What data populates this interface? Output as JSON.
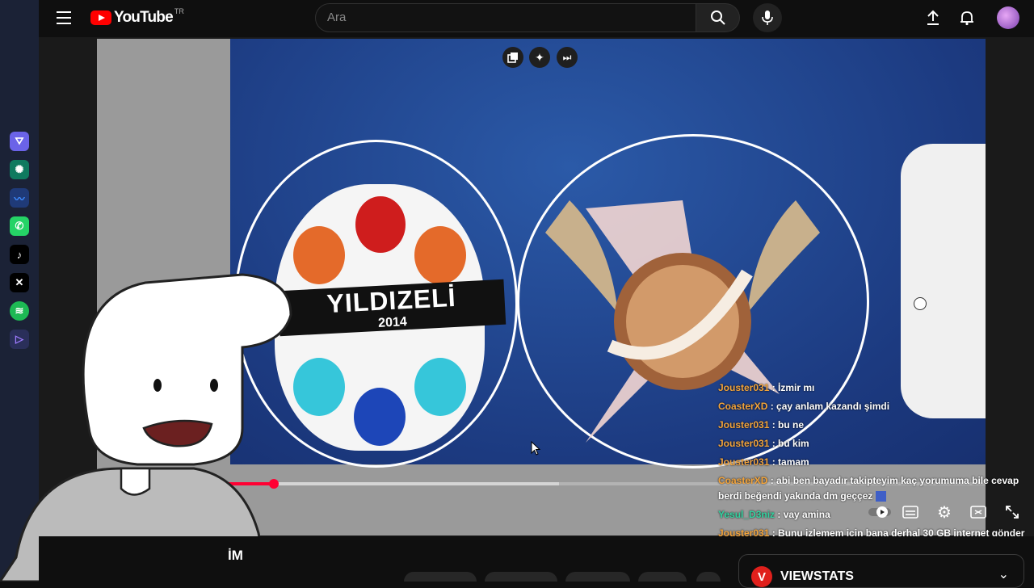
{
  "app": {
    "logo_text": "YouTube",
    "country_code": "TR"
  },
  "search": {
    "placeholder": "Ara"
  },
  "video": {
    "logo_badge_top": "YILDIZELİ",
    "logo_badge_year": "2014",
    "progress_fraction": 0.09,
    "buffer_fraction": 0.52
  },
  "chat": [
    {
      "user": "Jouster031",
      "message": "İzmir mı",
      "color": "#f3a43b"
    },
    {
      "user": "CoasterXD",
      "message": "çay anlam kazandı şimdi",
      "color": "#f3a43b"
    },
    {
      "user": "Jouster031",
      "message": "bu ne",
      "color": "#f3a43b"
    },
    {
      "user": "Jouster031",
      "message": "bu kim",
      "color": "#f3a43b"
    },
    {
      "user": "Jouster031",
      "message": "tamam",
      "color": "#f3a43b"
    },
    {
      "user": "CoasterXD",
      "message": "abi ben bayadır takipteyim kaç yorumuma bile cevap",
      "message_line2": "berdi beğendi yakında dm geççez",
      "color": "#f3a43b"
    },
    {
      "user": "Yesul_D3niz",
      "message": "vay amina",
      "color": "#33d2a0"
    },
    {
      "user": "Jouster031",
      "message": "Bunu izlemem için bana derhal 30 GB internet gönder",
      "color": "#f3a43b"
    }
  ],
  "below": {
    "title_fragment": "İM",
    "extension_name": "VIEWSTATS"
  },
  "colors": {
    "brand_red": "#ff0000",
    "progress_red": "#f03",
    "chat_user_orange": "#f3a43b",
    "chat_user_green": "#33d2a0",
    "sidebar_bg": "#1b2236"
  }
}
